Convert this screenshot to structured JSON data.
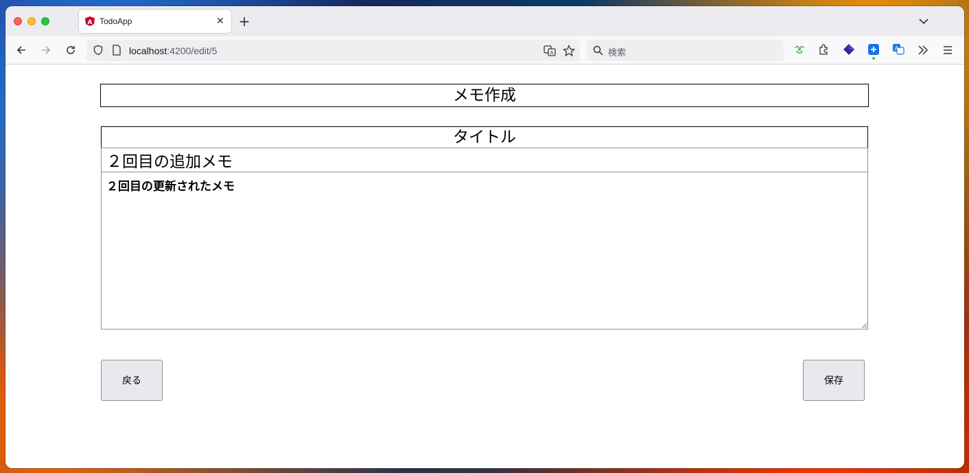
{
  "browser": {
    "tab_title": "TodoApp",
    "url_host": "localhost",
    "url_rest": ":4200/edit/5",
    "search_placeholder": "検索",
    "icons": [
      "back-arrow-icon",
      "forward-arrow-icon",
      "reload-icon",
      "shield-icon",
      "page-icon",
      "translate-icon",
      "star-icon",
      "search-icon",
      "extension-icon",
      "puzzle-icon",
      "overflow-icon",
      "menu-icon"
    ]
  },
  "page": {
    "heading": "メモ作成",
    "title_label": "タイトル",
    "title_value": "２回目の追加メモ",
    "body_value": "２回目の更新されたメモ",
    "back_button": "戻る",
    "save_button": "保存"
  }
}
